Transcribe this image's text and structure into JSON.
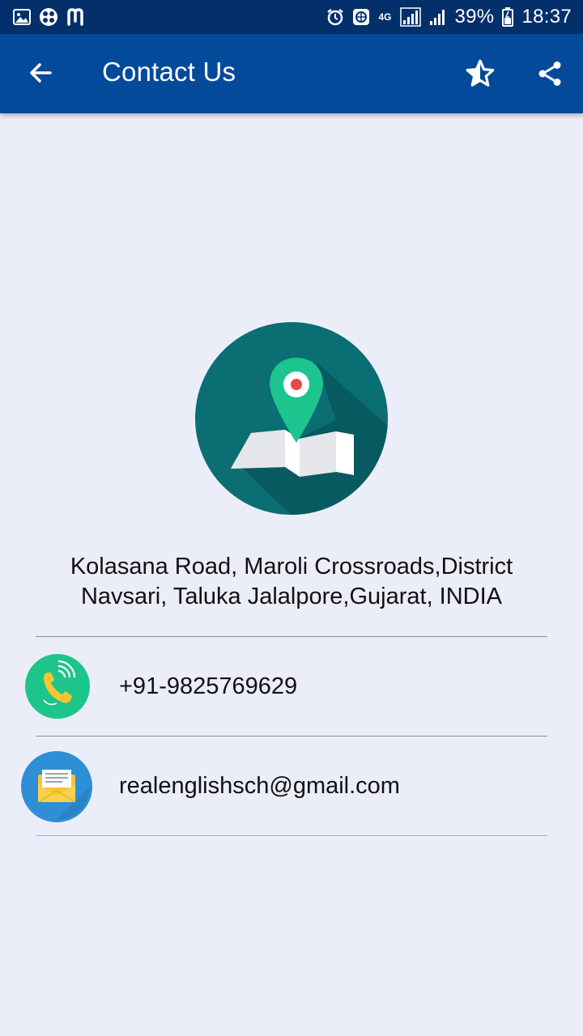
{
  "status_bar": {
    "battery_percent": "39%",
    "time": "18:37",
    "network": "4G",
    "icons": [
      "gallery-icon",
      "clover-icon",
      "m-app-icon",
      "alarm-icon",
      "data-saver-icon",
      "network-4g-icon",
      "signal-icon",
      "signal-icon",
      "battery-icon"
    ]
  },
  "app_bar": {
    "title": "Contact Us",
    "back_icon": "arrow-left-icon",
    "favorite_icon": "star-half-icon",
    "share_icon": "share-icon",
    "color": "#044a9b"
  },
  "main": {
    "logo_icon": "map-location-icon",
    "address": "Kolasana Road, Maroli Crossroads,District Navsari, Taluka Jalalpore,Gujarat, INDIA",
    "phone": {
      "icon": "phone-icon",
      "value": "+91-9825769629"
    },
    "email": {
      "icon": "email-icon",
      "value": "realenglishsch@gmail.com"
    }
  },
  "colors": {
    "background": "#ebeef8",
    "status_bar": "#03306b",
    "logo_circle": "#0b6e73",
    "pin": "#1cc48e",
    "phone_circle": "#1ec58b",
    "email_circle": "#2e8fd6"
  }
}
